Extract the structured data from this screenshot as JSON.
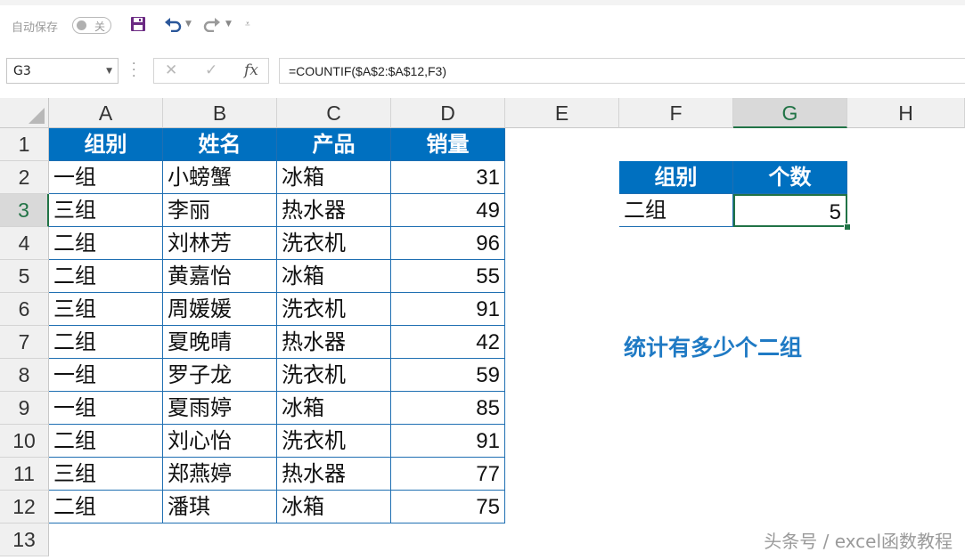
{
  "toolbar": {
    "autosave_label": "自动保存",
    "autosave_state": "关",
    "save_icon": "save-icon",
    "undo_icon": "undo-icon",
    "redo_icon": "redo-icon"
  },
  "formula_bar": {
    "name_box": "G3",
    "cancel_glyph": "✕",
    "enter_glyph": "✓",
    "fx_glyph": "fx",
    "formula": "=COUNTIF($A$2:$A$12,F3)"
  },
  "columns": [
    "A",
    "B",
    "C",
    "D",
    "E",
    "F",
    "G",
    "H"
  ],
  "active_column": "G",
  "rows": [
    "1",
    "2",
    "3",
    "4",
    "5",
    "6",
    "7",
    "8",
    "9",
    "10",
    "11",
    "12",
    "13"
  ],
  "active_row": "3",
  "table": {
    "headers": [
      "组别",
      "姓名",
      "产品",
      "销量"
    ],
    "records": [
      [
        "一组",
        "小螃蟹",
        "冰箱",
        "31"
      ],
      [
        "三组",
        "李丽",
        "热水器",
        "49"
      ],
      [
        "二组",
        "刘林芳",
        "洗衣机",
        "96"
      ],
      [
        "二组",
        "黄嘉怡",
        "冰箱",
        "55"
      ],
      [
        "三组",
        "周媛媛",
        "洗衣机",
        "91"
      ],
      [
        "二组",
        "夏晚晴",
        "热水器",
        "42"
      ],
      [
        "一组",
        "罗子龙",
        "洗衣机",
        "59"
      ],
      [
        "一组",
        "夏雨婷",
        "冰箱",
        "85"
      ],
      [
        "二组",
        "刘心怡",
        "洗衣机",
        "91"
      ],
      [
        "三组",
        "郑燕婷",
        "热水器",
        "77"
      ],
      [
        "二组",
        "潘琪",
        "冰箱",
        "75"
      ]
    ]
  },
  "summary": {
    "headers": [
      "组别",
      "个数"
    ],
    "group": "二组",
    "count": "5"
  },
  "note": "统计有多少个二组",
  "watermark": "头条号 / excel函数教程",
  "colors": {
    "header_fill": "#0070c0",
    "header_text": "#ffffff",
    "selection": "#217346",
    "note_text": "#1f7ac4"
  }
}
